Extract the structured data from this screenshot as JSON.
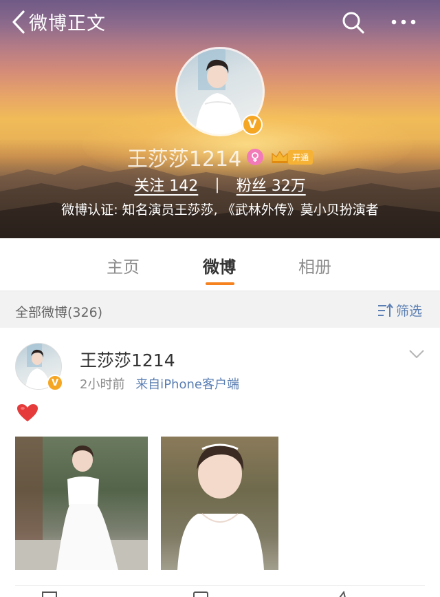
{
  "nav": {
    "back_label": "微博正文"
  },
  "profile": {
    "name": "王莎莎1214",
    "vip_tag": "开通",
    "verified_symbol": "V",
    "following": "关注  142",
    "followers": "粉丝  32万",
    "separator": "|",
    "verification": "微博认证: 知名演员王莎莎, 《武林外传》莫小贝扮演者"
  },
  "tabs": [
    {
      "label": "主页",
      "active": false
    },
    {
      "label": "微博",
      "active": true
    },
    {
      "label": "相册",
      "active": false
    }
  ],
  "filter": {
    "count_label": "全部微博(326)",
    "filter_label": "筛选"
  },
  "post": {
    "author": "王莎莎1214",
    "time": "2小时前",
    "source": "来自iPhone客户端",
    "content_icon": "red-heart-emoji",
    "photos": [
      {
        "description_icon": "photo-thumbnail"
      },
      {
        "description_icon": "photo-thumbnail"
      }
    ]
  },
  "colors": {
    "accent": "#f5821f",
    "link": "#5b7fb3",
    "verified_badge": "#f5a623",
    "gender_badge": "#f27ab8"
  }
}
